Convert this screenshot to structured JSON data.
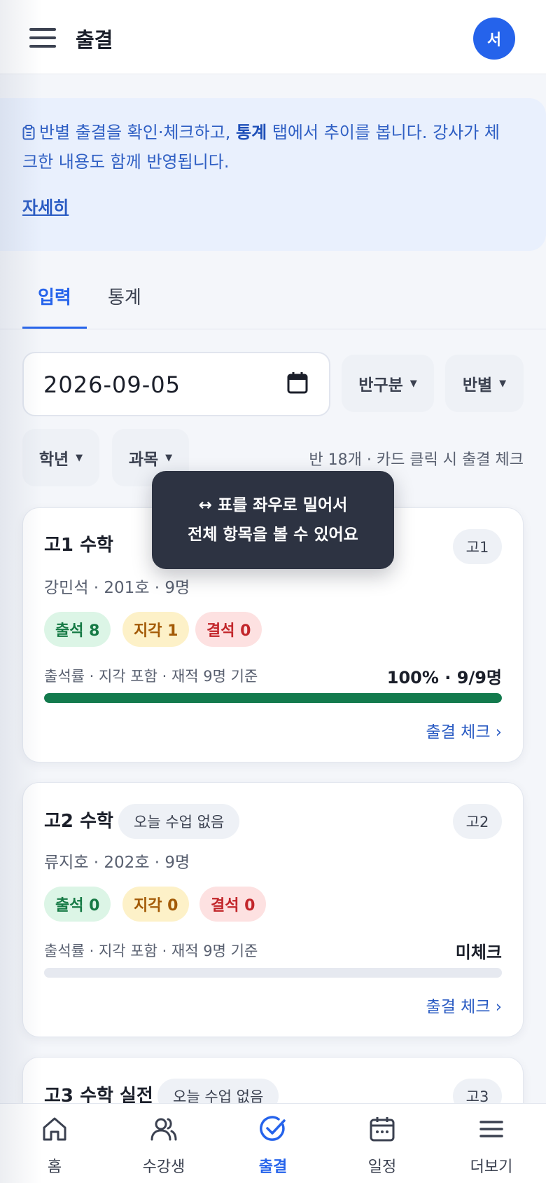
{
  "header": {
    "title": "출결",
    "avatar_initial": "서"
  },
  "notice": {
    "text_before": "반별 출결을 확인·체크하고, ",
    "text_bold": "통계",
    "text_after": " 탭에서 추이를 봅니다. 강사가 체크한 내용도 함께 반영됩니다.",
    "link": "자세히"
  },
  "tabs": [
    {
      "label": "입력",
      "active": true
    },
    {
      "label": "통계",
      "active": false
    }
  ],
  "filters": {
    "date": "2026-09-05",
    "class_type": "반구분",
    "by_class": "반별",
    "grade": "학년",
    "subject": "과목"
  },
  "summary": "반 18개 · 카드 클릭 시 출결 체크",
  "tooltip": {
    "line1": "↔ 표를 좌우로 밀어서",
    "line2": "전체 항목을 볼 수 있어요"
  },
  "cards": [
    {
      "title": "고1 수학",
      "no_class": "",
      "grade": "고1",
      "sub": "강민석 · 201호 · 9명",
      "attend": "출석 8",
      "late": "지각 1",
      "absent": "결석 0",
      "rate_label": "출석률 · 지각 포함 · 재적 9명 기준",
      "rate_value": "100% · 9/9명",
      "progress": 1.0,
      "check": "출결 체크 ›"
    },
    {
      "title": "고2 수학",
      "no_class": "오늘 수업 없음",
      "grade": "고2",
      "sub": "류지호 · 202호 · 9명",
      "attend": "출석 0",
      "late": "지각 0",
      "absent": "결석 0",
      "rate_label": "출석률 · 지각 포함 · 재적 9명 기준",
      "rate_value": "미체크",
      "progress": 0,
      "check": "출결 체크 ›"
    },
    {
      "title": "고3 수학 실전",
      "no_class": "오늘 수업 없음",
      "grade": "고3"
    }
  ],
  "bottom_nav": [
    {
      "label": "홈",
      "icon": "home-icon"
    },
    {
      "label": "수강생",
      "icon": "users-icon"
    },
    {
      "label": "출결",
      "icon": "check-circle-icon",
      "active": true
    },
    {
      "label": "일정",
      "icon": "calendar-icon"
    },
    {
      "label": "더보기",
      "icon": "menu-icon"
    }
  ],
  "colors": {
    "accent": "#2563eb",
    "progress": "#137a4d",
    "tooltip_bg": "#2d3342"
  }
}
